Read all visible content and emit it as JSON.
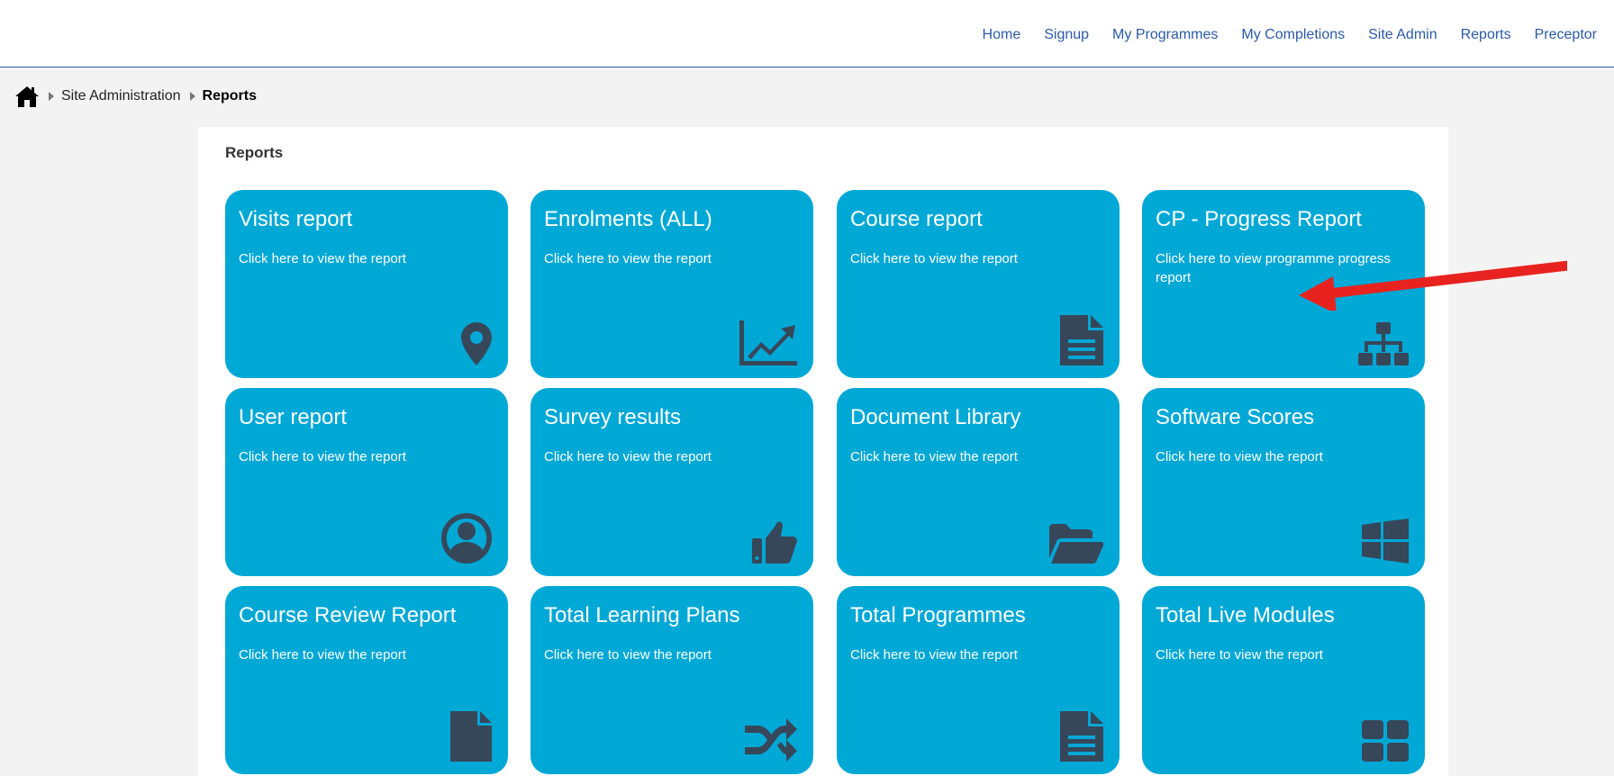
{
  "nav": {
    "items": [
      "Home",
      "Signup",
      "My Programmes",
      "My Completions",
      "Site Admin",
      "Reports",
      "Preceptor"
    ]
  },
  "breadcrumb": {
    "home_icon": "home-icon",
    "items": [
      "Site Administration",
      "Reports"
    ]
  },
  "panel": {
    "title": "Reports"
  },
  "tiles": [
    {
      "title": "Visits report",
      "desc": "Click here to view the report",
      "icon": "map-marker-icon"
    },
    {
      "title": "Enrolments (ALL)",
      "desc": "Click here to view the report",
      "icon": "line-chart-icon"
    },
    {
      "title": "Course report",
      "desc": "Click here to view the report",
      "icon": "document-icon"
    },
    {
      "title": "CP - Progress Report",
      "desc": "Click here to view programme progress report",
      "icon": "sitemap-icon"
    },
    {
      "title": "User report",
      "desc": "Click here to view the report",
      "icon": "user-circle-icon"
    },
    {
      "title": "Survey results",
      "desc": "Click here to view the report",
      "icon": "thumbs-up-icon"
    },
    {
      "title": "Document Library",
      "desc": "Click here to view the report",
      "icon": "folder-open-icon"
    },
    {
      "title": "Software Scores",
      "desc": "Click here to view the report",
      "icon": "windows-icon"
    },
    {
      "title": "Course Review Report",
      "desc": "Click here to view the report",
      "icon": "file-icon"
    },
    {
      "title": "Total Learning Plans",
      "desc": "Click here to view the report",
      "icon": "shuffle-icon"
    },
    {
      "title": "Total Programmes",
      "desc": "Click here to view the report",
      "icon": "document-icon"
    },
    {
      "title": "Total Live Modules",
      "desc": "Click here to view the report",
      "icon": "grid-icon"
    }
  ],
  "colors": {
    "tile_bg": "#00a8d6",
    "icon": "#37475a",
    "nav_link": "#2b5aa7",
    "annotation_arrow": "#e8231f"
  }
}
